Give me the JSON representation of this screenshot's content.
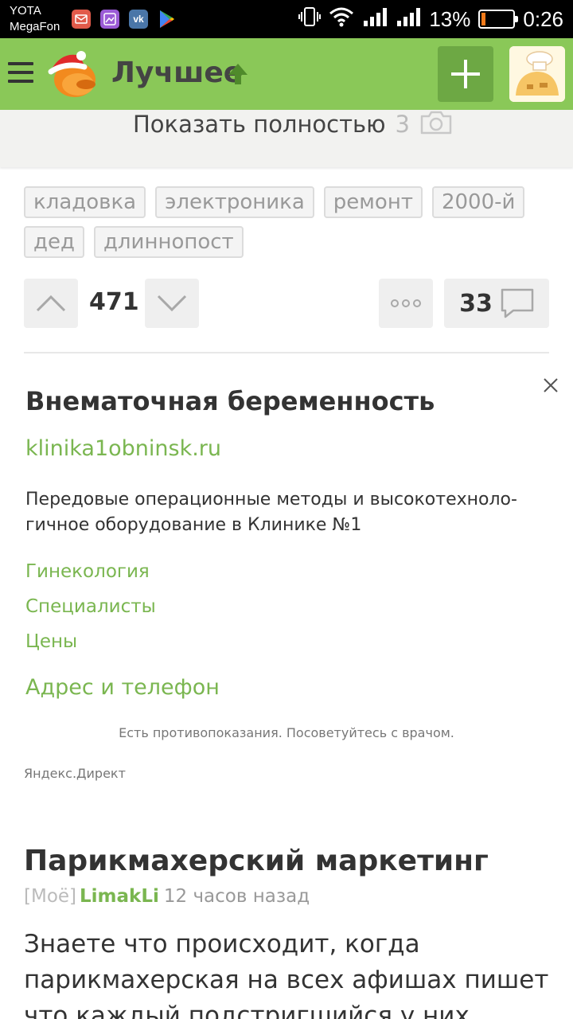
{
  "status_bar": {
    "carrier_1": "YOTA",
    "carrier_2": "MegaFon",
    "apps": [
      {
        "icon": "mail-app-icon",
        "color": "#e15a4a"
      },
      {
        "icon": "gallery-app-icon",
        "color": "#9b5bd6"
      },
      {
        "icon": "vk-app-icon",
        "color": "#4a76a8"
      },
      {
        "icon": "play-store-icon",
        "color": "#000000"
      }
    ],
    "battery_percent": "13%",
    "battery_level": 0.13,
    "time": "0:26"
  },
  "header": {
    "title": "Лучшее",
    "accent_color": "#8ac858",
    "add_button_color": "#6da844"
  },
  "show_full": {
    "label": "Показать полностью",
    "count": "3"
  },
  "tags": [
    "кладовка",
    "электроника",
    "ремонт",
    "2000-й",
    "дед",
    "длиннопост"
  ],
  "vote": {
    "rating": "471",
    "comments": "33"
  },
  "ad": {
    "title": "Внематочная беременность",
    "domain": "klinika1obninsk.ru",
    "description": "Передовые операционные методы и высокотехноло-гичное оборудование в Клинике №1",
    "links": [
      "Гинекология",
      "Специалисты",
      "Цены"
    ],
    "address_link": "Адрес и телефон",
    "warning": "Есть противопоказания. Посоветуйтесь с врачом.",
    "source": "Яндекс.Директ",
    "link_color": "#7ab650"
  },
  "post": {
    "title": "Парикмахерский маркетинг",
    "tag": "[Моё]",
    "author": "LimakLi",
    "time": "12 часов назад",
    "body": "Знаете что происходит, когда парикмахерская на всех афишах пишет что каждый подстригшийся у них получит"
  }
}
